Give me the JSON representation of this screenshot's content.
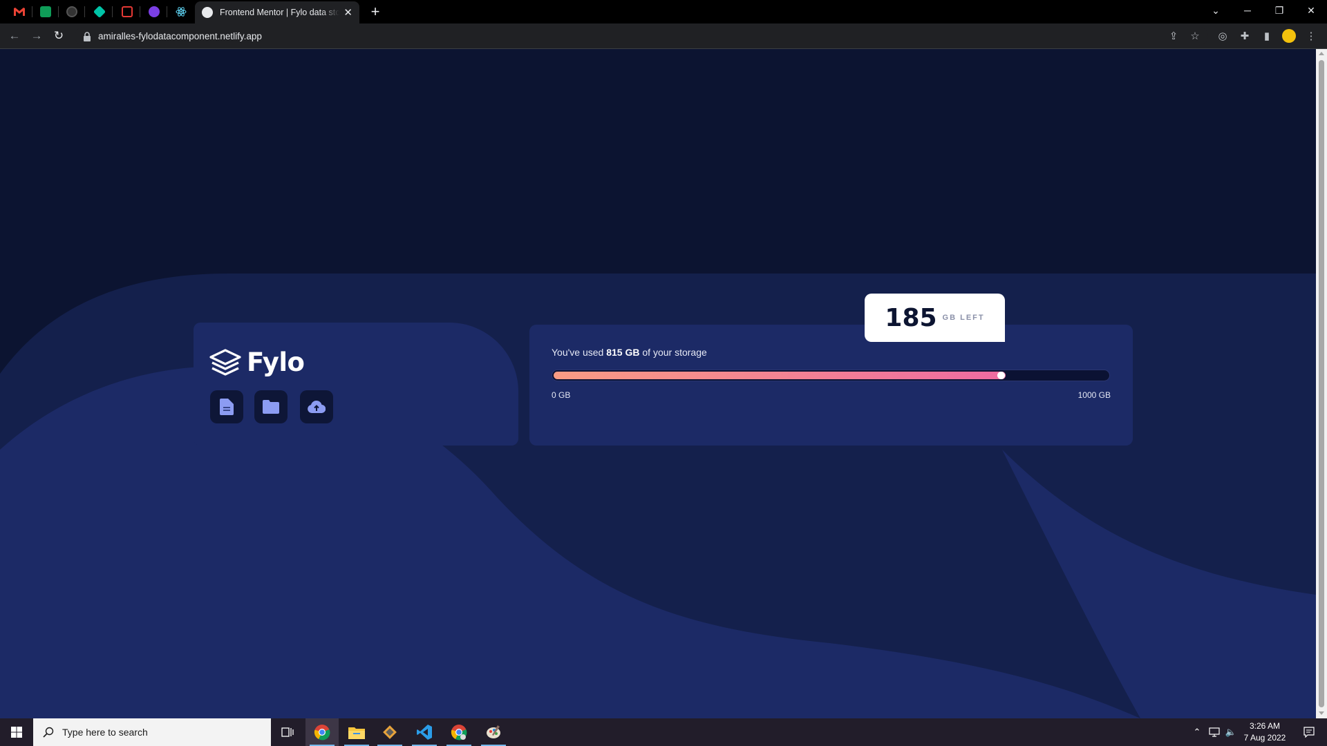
{
  "browser": {
    "pinned_tabs": [
      {
        "name": "gmail-tab",
        "color": "#ea4335"
      },
      {
        "name": "sheets-tab",
        "color": "#0f9d58"
      },
      {
        "name": "github-tab",
        "color": "#333333"
      },
      {
        "name": "app-tab-teal",
        "color": "#00c4a7"
      },
      {
        "name": "app-tab-red",
        "color": "#e53935"
      },
      {
        "name": "app-tab-purple",
        "color": "#7b3fe4"
      },
      {
        "name": "react-tab",
        "color": "#61dafb"
      }
    ],
    "active_tab_title": "Frontend Mentor | Fylo data storage component",
    "url": "amiralles-fylodatacomponent.netlify.app"
  },
  "page": {
    "brand": "Fylo",
    "usage": {
      "prefix": "You've used ",
      "used": "815 GB",
      "suffix": " of your storage",
      "used_fraction": 0.815,
      "min_label": "0 GB",
      "max_label": "1000 GB"
    },
    "remaining": {
      "value": "185",
      "unit": "GB LEFT"
    },
    "colors": {
      "background": "#0c1431",
      "card": "#1c2a66",
      "gradient_start": "#f99c84",
      "gradient_end": "#ee6ba1"
    }
  },
  "taskbar": {
    "search_placeholder": "Type here to search",
    "time": "3:26 AM",
    "date": "7 Aug 2022"
  }
}
